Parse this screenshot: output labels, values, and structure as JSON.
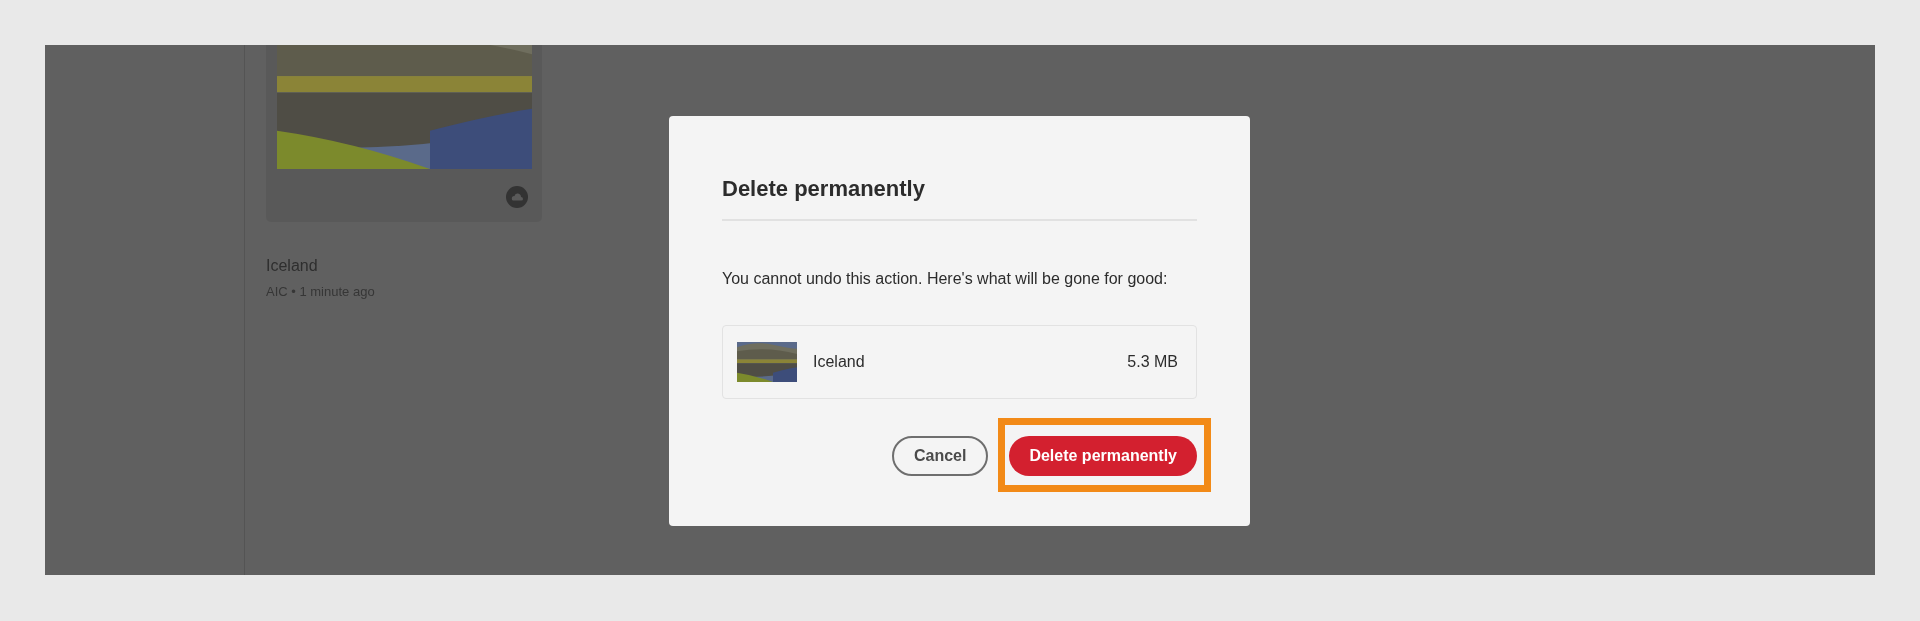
{
  "files": [
    {
      "name": "Iceland",
      "meta": "AIC • 1 minute ago",
      "kind": "picture"
    }
  ],
  "dialog": {
    "title": "Delete permanently",
    "message": "You cannot undo this action. Here's what will be gone for good:",
    "items": [
      {
        "name": "Iceland",
        "size": "5.3 MB",
        "kind": "picture"
      }
    ],
    "buttons": [
      {
        "label": "Cancel",
        "kind": "secondary",
        "highlighted": false
      },
      {
        "label": "Delete permanently",
        "kind": "primary",
        "highlighted": true
      }
    ]
  }
}
